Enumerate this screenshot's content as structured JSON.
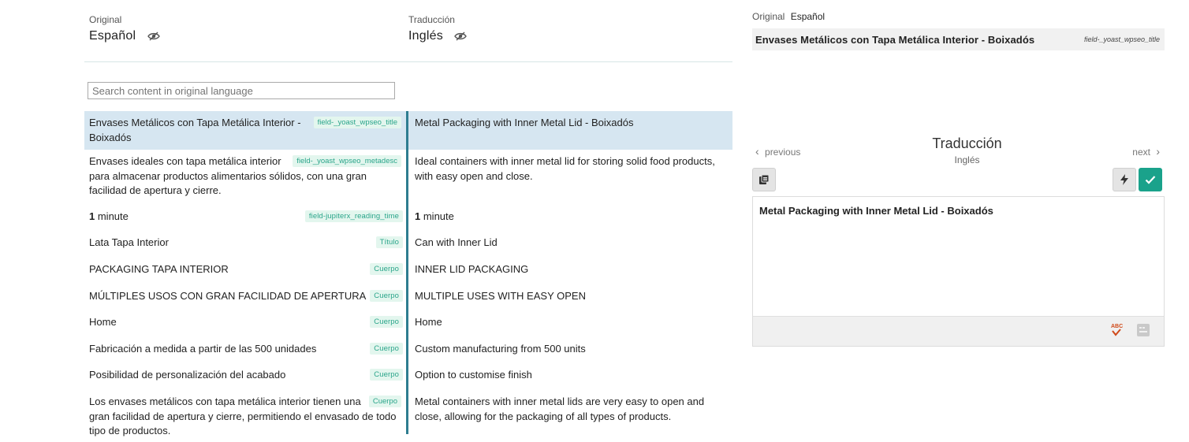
{
  "header": {
    "original_caption": "Original",
    "original_language": "Español",
    "translation_caption": "Traducción",
    "translation_language": "Inglés"
  },
  "search": {
    "placeholder": "Search content in original language"
  },
  "rows": [
    {
      "original": "Envases Metálicos con Tapa Metálica Interior - Boixadós",
      "tag": "field-_yoast_wpseo_title",
      "translation": "Metal Packaging with Inner Metal Lid - Boixadós",
      "selected": true
    },
    {
      "original": "Envases ideales con tapa metálica interior para almacenar productos alimentarios sólidos, con una gran facilidad de apertura y cierre.",
      "tag": "field-_yoast_wpseo_metadesc",
      "translation": "Ideal containers with inner metal lid for storing solid food products, with easy open and close."
    },
    {
      "original_num": "1",
      "original_rest": " minute",
      "tag": "field-jupiterx_reading_time",
      "translation_num": "1",
      "translation_rest": " minute"
    },
    {
      "original": "Lata Tapa Interior",
      "tag": "Título",
      "translation": "Can with Inner Lid"
    },
    {
      "original": "PACKAGING TAPA INTERIOR",
      "tag": "Cuerpo",
      "translation": "INNER LID PACKAGING"
    },
    {
      "original": "MÚLTIPLES USOS CON GRAN FACILIDAD DE APERTURA",
      "tag": "Cuerpo",
      "translation": "MULTIPLE USES WITH EASY OPEN"
    },
    {
      "original": "Home",
      "tag": "Cuerpo",
      "translation": "Home"
    },
    {
      "original": "Fabricación a medida a partir de las 500 unidades",
      "tag": "Cuerpo",
      "translation": "Custom manufacturing from 500 units"
    },
    {
      "original": "Posibilidad de personalización del acabado",
      "tag": "Cuerpo",
      "translation": "Option to customise finish"
    },
    {
      "original": "Los envases metálicos con tapa metálica interior tienen una gran facilidad de apertura y cierre, permitiendo el envasado de todo tipo de productos.",
      "tag": "Cuerpo",
      "translation": "Metal containers with inner metal lids are very easy to open and close, allowing for the packaging of all types of products."
    }
  ],
  "panel": {
    "original_caption": "Original",
    "original_language": "Español",
    "original_text": "Envases Metálicos con Tapa Metálica Interior - Boixadós",
    "original_field": "field-_yoast_wpseo_title",
    "prev_label": "previous",
    "next_label": "next",
    "title": "Traducción",
    "subtitle": "Inglés",
    "editor_text": "Metal Packaging with Inner Metal Lid - Boixadós"
  },
  "colors": {
    "accent": "#1aa28b",
    "divider": "#2e7d90",
    "selected_row": "#d6e6f1",
    "tag_text": "#2aa58a",
    "tag_bg": "#e3f6ee",
    "spellcheck": "#d04a1a"
  },
  "icons": {
    "visibility": "eye-slash-icon",
    "copy": "copy-original-icon",
    "machine": "lightning-icon",
    "save": "checkmark-icon",
    "spell": "spellcheck-icon",
    "keyboard": "keyboard-icon",
    "prev": "chevron-left-icon",
    "next": "chevron-right-icon"
  }
}
